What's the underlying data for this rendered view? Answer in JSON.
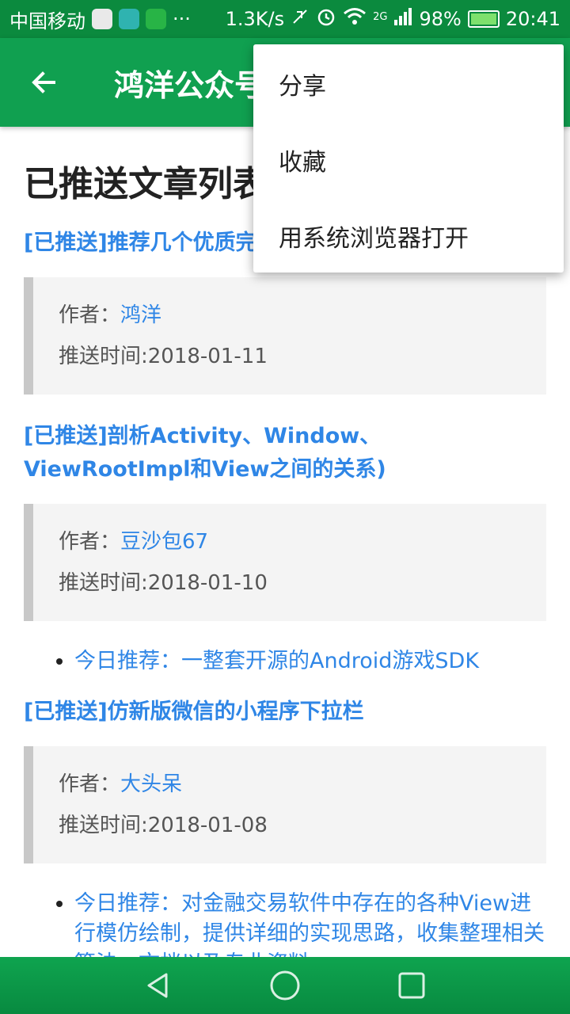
{
  "status_bar": {
    "carrier": "中国移动",
    "more": "···",
    "net_speed": "1.3K/s",
    "signal_type": "2G",
    "battery": "98%",
    "time": "20:41"
  },
  "toolbar": {
    "title": "鸿洋公众号",
    "back_icon": "arrow-back-icon"
  },
  "page": {
    "title": "已推送文章列表"
  },
  "articles": [
    {
      "title": "[已推送]推荐几个优质完",
      "author_label": "作者：",
      "author": "鸿洋",
      "date": "推送时间:2018-01-11",
      "recommend": []
    },
    {
      "title": "[已推送]剖析Activity、Window、ViewRootImpl和View之间的关系)",
      "author_label": "作者：",
      "author": "豆沙包67",
      "date": "推送时间:2018-01-10",
      "recommend": [
        "今日推荐：一整套开源的Android游戏SDK"
      ]
    },
    {
      "title": "[已推送]仿新版微信的小程序下拉栏",
      "author_label": "作者：",
      "author": "大头呆",
      "date": "推送时间:2018-01-08",
      "recommend": [
        "今日推荐：对金融交易软件中存在的各种View进行模仿绘制，提供详细的实现思路，收集整理相关算法、文档以及专业资料"
      ]
    }
  ],
  "menu": {
    "items": [
      "分享",
      "收藏",
      "用系统浏览器打开"
    ]
  },
  "nav_bar": {
    "back": "nav-back-icon",
    "home": "nav-home-icon",
    "recent": "nav-recent-icon"
  },
  "colors": {
    "primary": "#10a050",
    "status": "#0b8a3e",
    "link": "#2f86e6"
  }
}
